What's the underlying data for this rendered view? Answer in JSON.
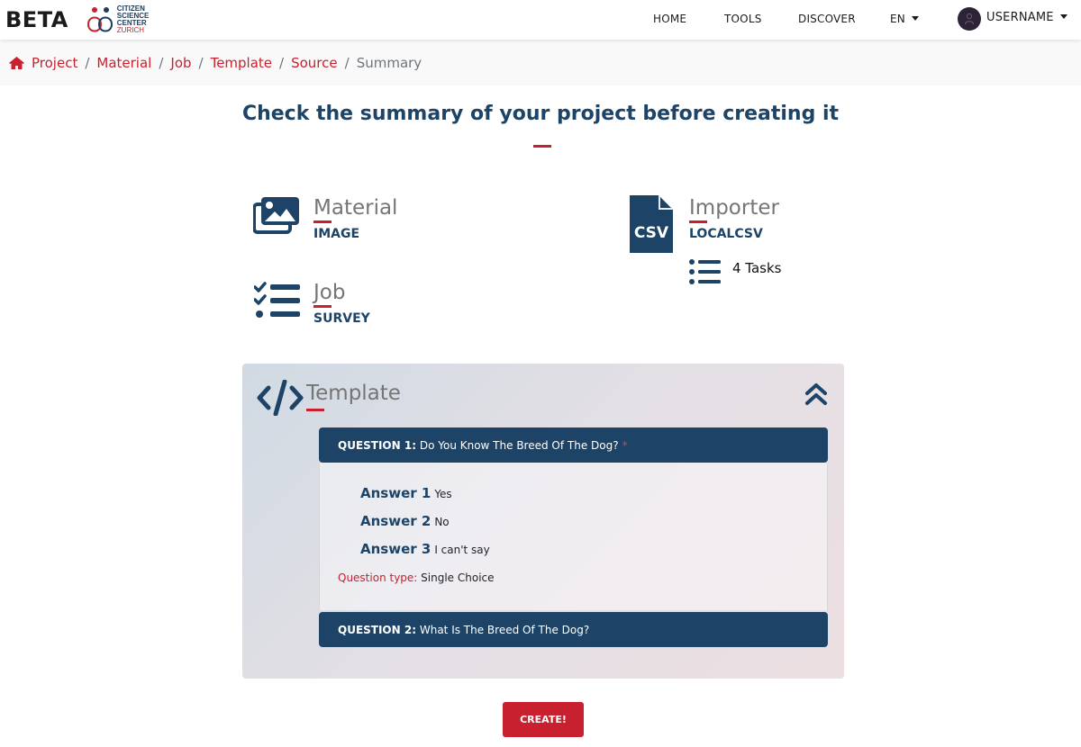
{
  "navbar": {
    "brand": "BETA",
    "logo_lines": [
      "CITIZEN",
      "SCIENCE",
      "CENTER",
      "ZURICH"
    ],
    "links": [
      "HOME",
      "TOOLS",
      "DISCOVER"
    ],
    "language": "EN",
    "username": "USERNAME"
  },
  "breadcrumb": {
    "items": [
      "Project",
      "Material",
      "Job",
      "Template",
      "Source"
    ],
    "current": "Summary",
    "separator": "/"
  },
  "headline": "Check the summary of your project before creating it",
  "summary": {
    "material": {
      "title": "Material",
      "value": "IMAGE",
      "icon": "images-icon"
    },
    "job": {
      "title": "Job",
      "value": "SURVEY",
      "icon": "tasks-icon"
    },
    "importer": {
      "title": "Importer",
      "value": "LOCALCSV",
      "icon": "csv-file-icon",
      "tasks_count": "4 Tasks"
    }
  },
  "template": {
    "title": "Template",
    "questions": [
      {
        "label": "QUESTION 1:",
        "text": "Do You Know The Breed Of The Dog?",
        "required_mark": "*",
        "answers": [
          {
            "label": "Answer 1",
            "text": "Yes"
          },
          {
            "label": "Answer 2",
            "text": "No"
          },
          {
            "label": "Answer 3",
            "text": "I can't say"
          }
        ],
        "type_label": "Question type:",
        "type_value": "Single Choice"
      },
      {
        "label": "QUESTION 2:",
        "text": "What Is The Breed Of The Dog?"
      }
    ]
  },
  "actions": {
    "create": "CREATE!"
  },
  "colors": {
    "primary": "#1d4467",
    "accent": "#c8202f",
    "muted": "#757575"
  }
}
